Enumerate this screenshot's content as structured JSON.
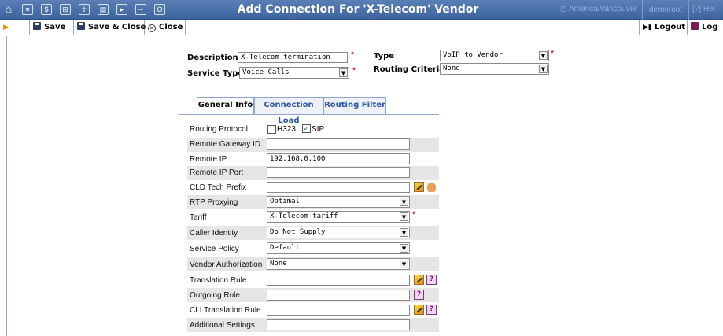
{
  "topbar": {
    "title": "Add Connection For 'X-Telecom' Vendor",
    "timezone": "America/Vancouver",
    "timezone_icon": "clock-icon",
    "user": "demoroot",
    "help": "Hel",
    "icons": [
      "home-icon",
      "customers-icon",
      "billing-icon",
      "tools-icon",
      "users-icon",
      "table-icon",
      "export-icon",
      "chart-icon",
      "search-icon"
    ]
  },
  "toolbar": {
    "save": "Save",
    "save_close": "Save & Close",
    "close": "Close",
    "logout": "Logout",
    "log": "Log"
  },
  "header": {
    "description_label": "Description",
    "description_value": "X-Telecom termination",
    "service_type_label": "Service Type",
    "service_type_value": "Voice Calls",
    "type_label": "Type",
    "type_value": "VoIP to Vendor",
    "routing_criteria_label": "Routing Criteria",
    "routing_criteria_value": "None",
    "required_mark": "*"
  },
  "tabs": [
    {
      "label": "General Info",
      "active": true
    },
    {
      "label": "Connection Load",
      "active": false
    },
    {
      "label": "Routing Filter",
      "active": false
    }
  ],
  "fields": {
    "routing_protocol": {
      "label": "Routing Protocol",
      "h323": "H323",
      "h323_checked": false,
      "sip": "SIP",
      "sip_checked": true
    },
    "remote_gateway_id": {
      "label": "Remote Gateway ID",
      "value": ""
    },
    "remote_ip": {
      "label": "Remote IP",
      "value": "192.168.0.100"
    },
    "remote_ip_port": {
      "label": "Remote IP Port",
      "value": ""
    },
    "cld_tech_prefix": {
      "label": "CLD Tech Prefix",
      "value": ""
    },
    "rtp_proxying": {
      "label": "RTP Proxying",
      "value": "Optimal"
    },
    "tariff": {
      "label": "Tariff",
      "value": "X-Telecom tariff"
    },
    "caller_identity": {
      "label": "Caller Identity",
      "value": "Do Not Supply"
    },
    "service_policy": {
      "label": "Service Policy",
      "value": "Default"
    },
    "vendor_authorization": {
      "label": "Vendor Authorization",
      "value": "None"
    },
    "translation_rule": {
      "label": "Translation Rule",
      "value": ""
    },
    "outgoing_rule": {
      "label": "Outgoing Rule",
      "value": ""
    },
    "cli_translation_rule": {
      "label": "CLI Translation Rule",
      "value": ""
    },
    "additional_settings": {
      "label": "Additional Settings",
      "value": ""
    }
  },
  "help_glyph": "?",
  "check_glyph": "✓",
  "chevron_glyph": "▼",
  "colors": {
    "topbar": "#4a70aa",
    "row_bg": "#e6e6e6",
    "required": "#d00000",
    "tab_link": "#2b56a3"
  }
}
